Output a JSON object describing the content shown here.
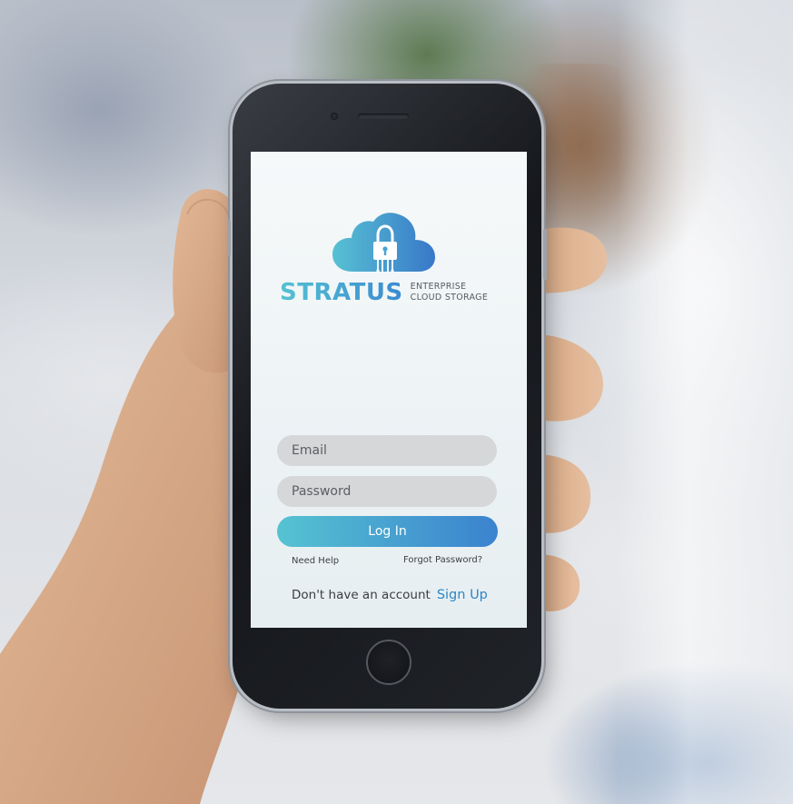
{
  "app": {
    "brand_name": "STRATUS",
    "tagline_line1": "ENTERPRISE",
    "tagline_line2": "CLOUD STORAGE"
  },
  "login_form": {
    "email_placeholder": "Email",
    "password_placeholder": "Password",
    "login_label": "Log In",
    "need_help_label": "Need Help",
    "forgot_password_label": "Forgot Password?",
    "no_account_text": "Don't have an account",
    "signup_label": "Sign Up"
  },
  "colors": {
    "accent_start": "#55c3d1",
    "accent_end": "#3b82cf",
    "link": "#2c86c6",
    "field_bg": "#d6d7d9"
  },
  "icons": {
    "logo": "cloud-lock-icon"
  }
}
